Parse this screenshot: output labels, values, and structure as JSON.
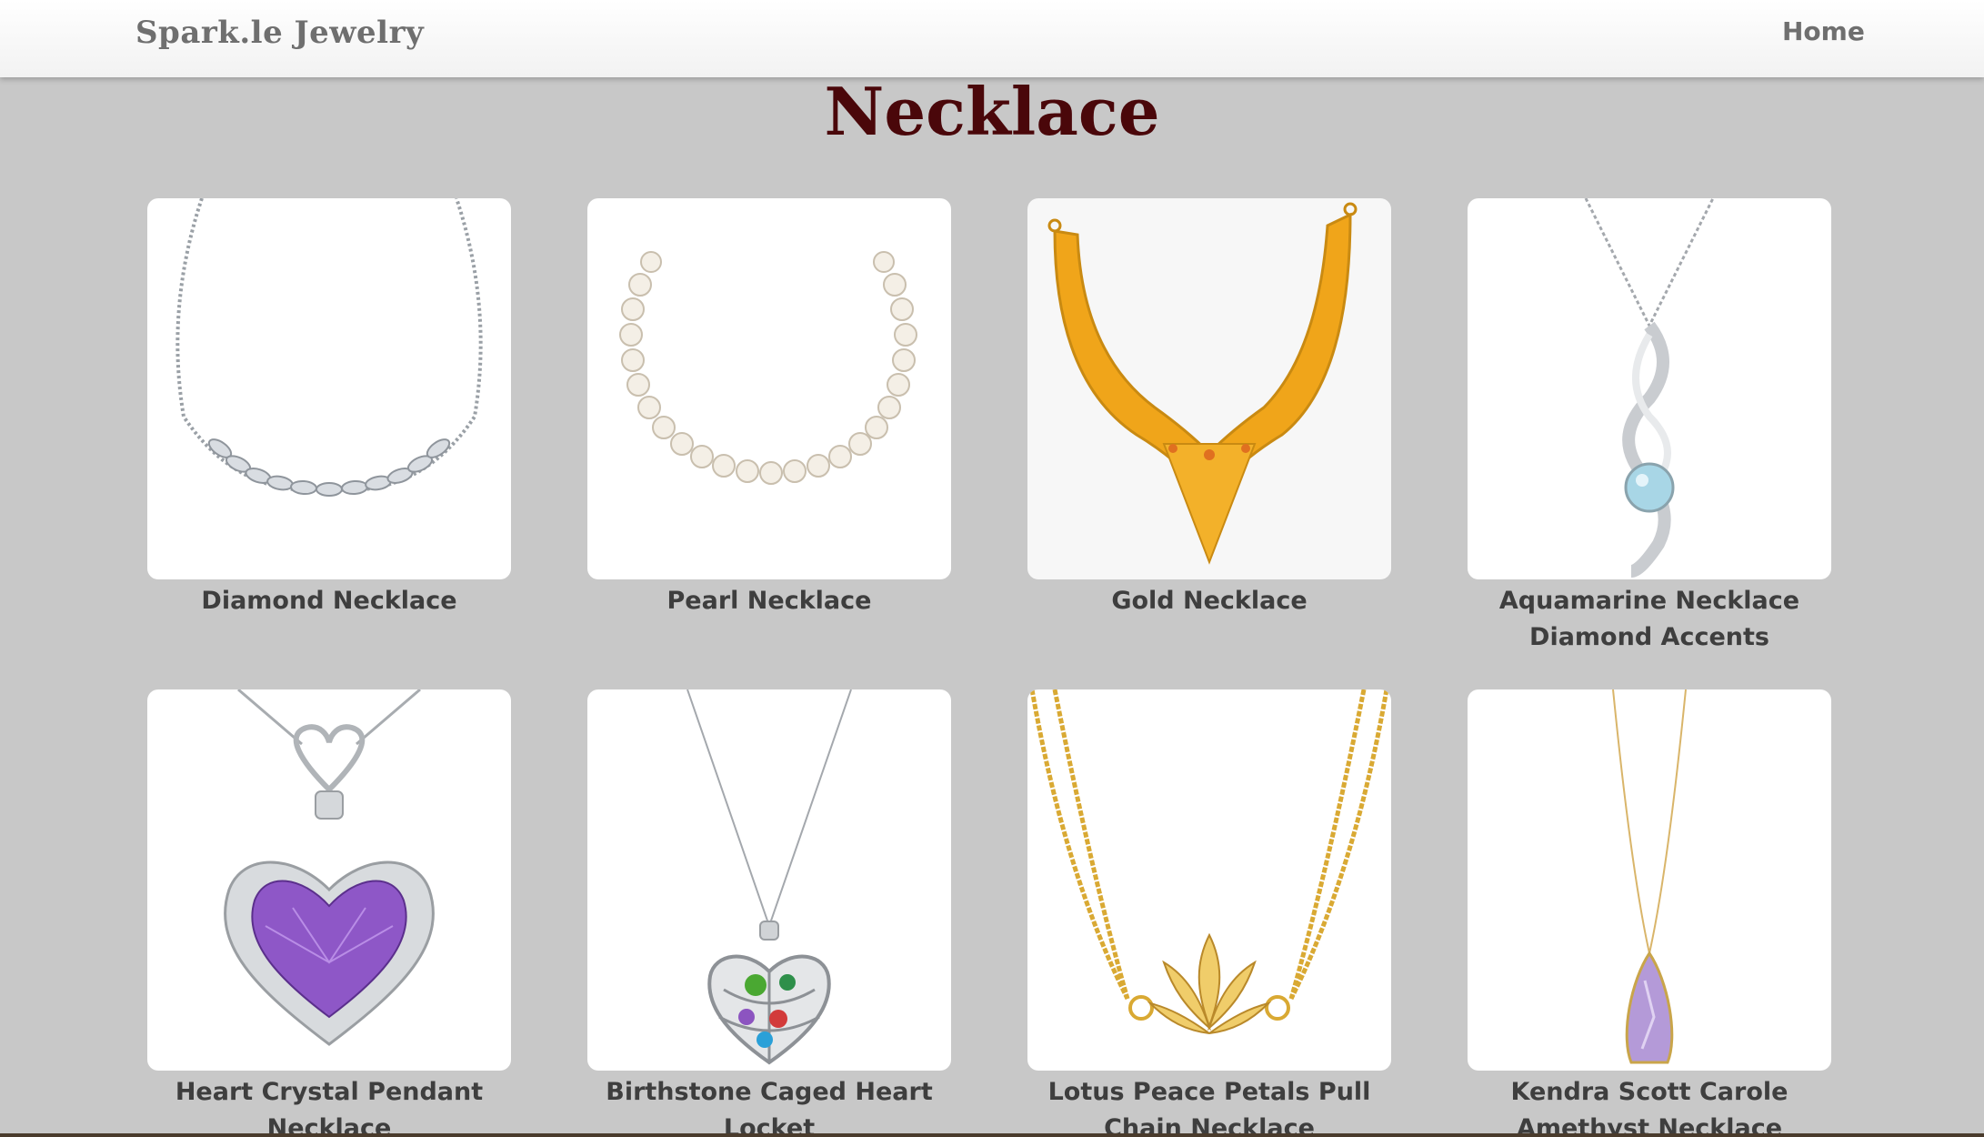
{
  "nav": {
    "brand": "Spark.le Jewelry",
    "home": "Home"
  },
  "page": {
    "title": "Necklace"
  },
  "products": [
    {
      "name": "Diamond Necklace",
      "icon": "diamond-necklace-image"
    },
    {
      "name": "Pearl Necklace",
      "icon": "pearl-necklace-image"
    },
    {
      "name": "Gold Necklace",
      "icon": "gold-necklace-image"
    },
    {
      "name": "Aquamarine Necklace Diamond Accents",
      "icon": "aquamarine-necklace-image"
    },
    {
      "name": "Heart Crystal Pendant Necklace",
      "icon": "heart-crystal-pendant-image"
    },
    {
      "name": "Birthstone Caged Heart Locket",
      "icon": "caged-heart-locket-image"
    },
    {
      "name": "Lotus Peace Petals Pull Chain Necklace",
      "icon": "lotus-necklace-image"
    },
    {
      "name": "Kendra Scott Carole Amethyst Necklace",
      "icon": "amethyst-necklace-image"
    }
  ],
  "colors": {
    "background": "#c8c8c8",
    "title": "#4a070a",
    "caption": "#3e3e3e",
    "nav_text": "#6f6f6f"
  }
}
